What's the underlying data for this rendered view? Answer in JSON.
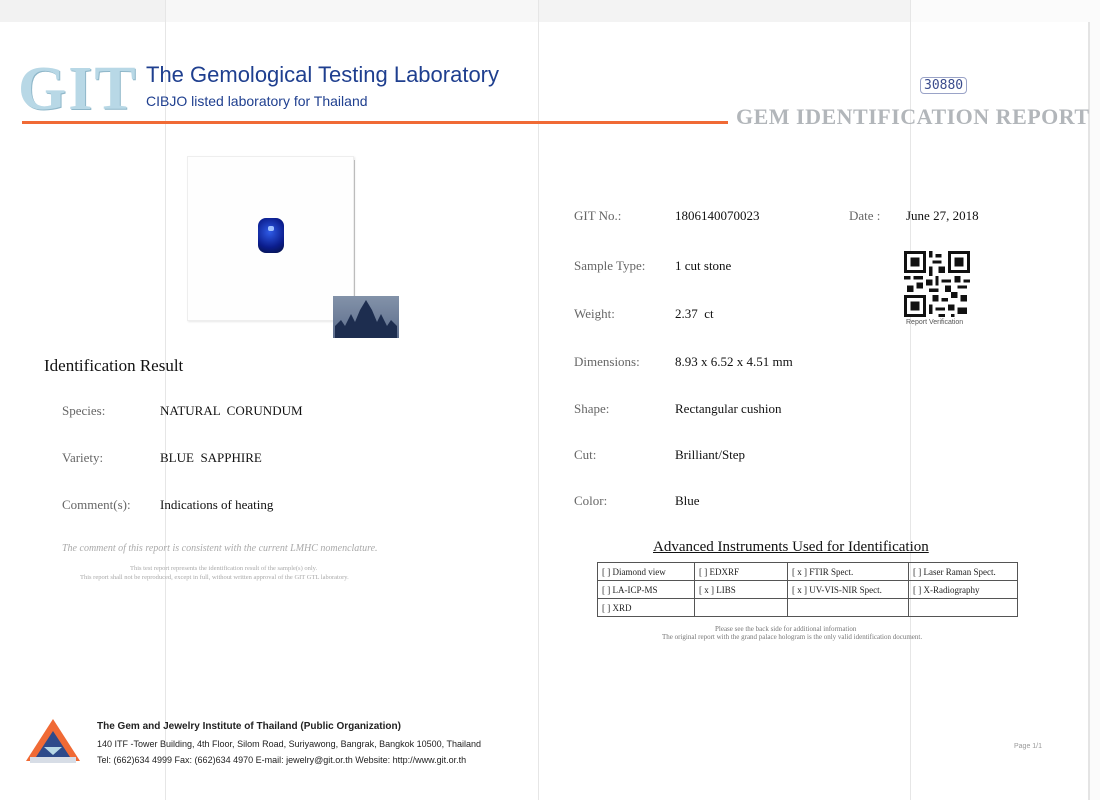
{
  "header": {
    "logo_text": "GIT",
    "lab_name": "The Gemological Testing Laboratory",
    "lab_subtitle": "CIBJO listed laboratory for Thailand",
    "report_title": "GEM IDENTIFICATION REPORT",
    "handwritten_number": "30880"
  },
  "details": {
    "git_no_label": "GIT No.:",
    "git_no_value": "1806140070023",
    "date_label": "Date :",
    "date_value": "June 27, 2018",
    "sample_type_label": "Sample Type:",
    "sample_type_value": "1 cut stone",
    "weight_label": "Weight:",
    "weight_value": "2.37  ct",
    "dimensions_label": "Dimensions:",
    "dimensions_value": "8.93 x 6.52 x 4.51 mm",
    "shape_label": "Shape:",
    "shape_value": "Rectangular cushion",
    "cut_label": "Cut:",
    "cut_value": "Brilliant/Step",
    "color_label": "Color:",
    "color_value": "Blue"
  },
  "qr": {
    "caption": "Report Verification"
  },
  "identification": {
    "title": "Identification Result",
    "species_label": "Species:",
    "species_value": "NATURAL  CORUNDUM",
    "variety_label": "Variety:",
    "variety_value": "BLUE  SAPPHIRE",
    "comment_label": "Comment(s):",
    "comment_value": "Indications of heating",
    "disclaimer": "The comment of this report is consistent with the current LMHC nomenclature.",
    "fine_line1": "This test report represents the identification result of the sample(s) only.",
    "fine_line2": "This report shall not be reproduced, except in full, without written approval of the GIT GTL laboratory."
  },
  "instruments": {
    "title": "Advanced Instruments Used for Identification",
    "rows": [
      [
        "[    ] Diamond view",
        "[    ] EDXRF",
        "[ x ] FTIR Spect.",
        "[    ] Laser Raman Spect."
      ],
      [
        "[    ] LA-ICP-MS",
        "[ x ] LIBS",
        "[ x ] UV-VIS-NIR Spect.",
        "[    ] X-Radiography"
      ],
      [
        "[    ] XRD",
        "",
        "",
        ""
      ]
    ],
    "note1": "Please see the back side for additional information",
    "note2": "The original report with the grand palace hologram is the only valid identification document."
  },
  "footer": {
    "org": "The Gem and Jewelry Institute of Thailand (Public Organization)",
    "address": "140 ITF -Tower Building, 4th Floor, Silom Road, Suriyawong, Bangrak, Bangkok 10500, Thailand",
    "contact": "Tel: (662)634 4999 Fax: (662)634 4970  E-mail: jewelry@git.or.th  Website: http://www.git.or.th",
    "page": "Page 1/1"
  },
  "colors": {
    "brand_blue": "#1f3f8f",
    "accent_orange": "#f06a35",
    "gem_blue": "#0b1d8d"
  }
}
